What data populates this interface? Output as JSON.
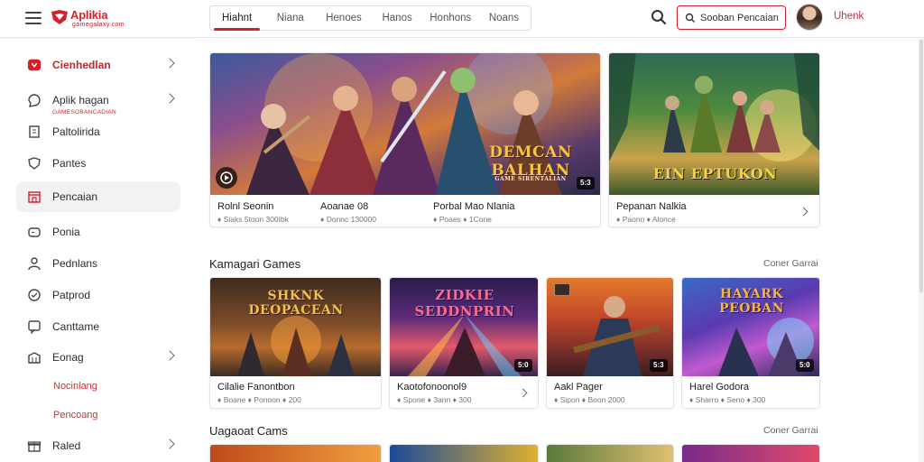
{
  "header": {
    "logo_text": "Aplikia",
    "logo_sub": "gamegalaxy.com",
    "tabs": [
      "Hiahnt",
      "Niana",
      "Henoes",
      "Hanos",
      "Honhons",
      "Noans"
    ],
    "search_label": "Sooban Pencaian",
    "user_link": "Uhenk"
  },
  "sidebar": {
    "brand_title": "Cienhedlan",
    "brand_sub": "GAMESOBANCADIAN",
    "items": [
      {
        "label": "Aplik hagan",
        "icon": "chat-icon",
        "chevron": true
      },
      {
        "label": "Paltolirida",
        "icon": "document-icon",
        "chevron": false
      },
      {
        "label": "Pantes",
        "icon": "shield-icon",
        "chevron": false
      },
      {
        "label": "Pencaian",
        "icon": "store-icon",
        "chevron": false,
        "active": true
      },
      {
        "label": "Ponia",
        "icon": "controller-icon",
        "chevron": false
      },
      {
        "label": "Pednlans",
        "icon": "person-icon",
        "chevron": false
      },
      {
        "label": "Patprod",
        "icon": "badge-icon",
        "chevron": false
      },
      {
        "label": "Canttame",
        "icon": "chat-square-icon",
        "chevron": false
      },
      {
        "label": "Eonag",
        "icon": "building-icon",
        "chevron": true
      },
      {
        "label": "Nocinlang",
        "icon": "",
        "chevron": false,
        "sub": true
      },
      {
        "label": "Pencoang",
        "icon": "",
        "chevron": false,
        "sub": true
      },
      {
        "label": "Raled",
        "icon": "gift-icon",
        "chevron": true
      }
    ]
  },
  "featured": {
    "main_art_title": "DEMCAN BALHAN",
    "main_art_sub": "GAME SIRENTALIAN",
    "main_badge": "5:3",
    "main_captions": [
      {
        "title": "Rolnl Seonin",
        "meta": "♦ Siaks 5toon 300Ibk"
      },
      {
        "title": "Aoanae 08",
        "meta": "♦ Donnc 130000"
      },
      {
        "title": "Porbal Mao Nlania",
        "meta": "♦ Poaes ♦ 1Cone"
      }
    ],
    "side_art_title": "EIN EPTUKON",
    "side_caption": {
      "title": "Pepanan Nalkia",
      "meta": "♦ Paono ♦ Alonce"
    }
  },
  "sections": [
    {
      "title": "Kamagari Games",
      "see_all": "Coner Garrai",
      "cards": [
        {
          "art_title": "SHKNK DEOPACEAN",
          "title": "Cilalie Fanontbon",
          "meta": "♦ Boane ♦ Ponoon ♦ 200",
          "badge": ""
        },
        {
          "art_title": "ZIDKIE SEDDNPRIN",
          "title": "Kaotofonoonol9",
          "meta": "♦ Spone ♦ 3ann ♦ 300",
          "badge": "5:0"
        },
        {
          "art_title": "",
          "title": "Aakl Pager",
          "meta": "♦ Sipon ♦ Boon 2000",
          "badge": "5:3"
        },
        {
          "art_title": "HAYARK PEOBAN",
          "title": "Harel Godora",
          "meta": "♦ Sharro ♦ Seno ♦ 300",
          "badge": "5:0"
        }
      ]
    },
    {
      "title": "Uagaoat Cams",
      "see_all": "Coner Garrai"
    }
  ]
}
